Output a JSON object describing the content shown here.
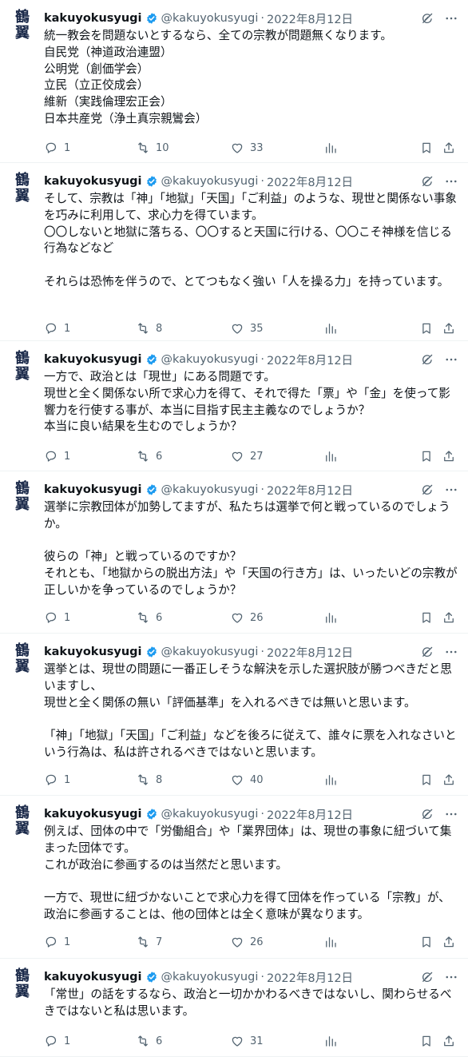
{
  "tweets": [
    {
      "avatar_glyph": "鶴翼",
      "user_name": "kakuyokusyugi",
      "handle": "@kakuyokusyugi",
      "separator": "·",
      "date": "2022年8月12日",
      "text": "統一教会を問題ないとするなら、全ての宗教が問題無くなります。\n自民党（神道政治連盟）\n公明党（創価学会）\n立民（立正佼成会）\n維新（実践倫理宏正会）\n日本共産党（浄土真宗親鸞会）",
      "replies": "1",
      "retweets": "10",
      "likes": "33"
    },
    {
      "avatar_glyph": "鶴翼",
      "user_name": "kakuyokusyugi",
      "handle": "@kakuyokusyugi",
      "separator": "·",
      "date": "2022年8月12日",
      "text": "そして、宗教は「神」「地獄」「天国」「ご利益」のような、現世と関係ない事象を巧みに利用して、求心力を得ています。\n〇〇しないと地獄に落ちる、〇〇すると天国に行ける、〇〇こそ神様を信じる行為などなど\n\nそれらは恐怖を伴うので、とてつもなく強い「人を操る力」を持っています。",
      "replies": "1",
      "retweets": "8",
      "likes": "35"
    },
    {
      "avatar_glyph": "鶴翼",
      "user_name": "kakuyokusyugi",
      "handle": "@kakuyokusyugi",
      "separator": "·",
      "date": "2022年8月12日",
      "text": "一方で、政治とは「現世」にある問題です。\n現世と全く関係ない所で求心力を得て、それで得た「票」や「金」を使って影響力を行使する事が、本当に目指す民主主義なのでしょうか？\n本当に良い結果を生むのでしょうか？",
      "replies": "1",
      "retweets": "6",
      "likes": "27"
    },
    {
      "avatar_glyph": "鶴翼",
      "user_name": "kakuyokusyugi",
      "handle": "@kakuyokusyugi",
      "separator": "·",
      "date": "2022年8月12日",
      "text": "選挙に宗教団体が加勢してますが、私たちは選挙で何と戦っているのでしょうか。\n\n彼らの「神」と戦っているのですか？\nそれとも、「地獄からの脱出方法」や「天国の行き方」は、いったいどの宗教が正しいかを争っているのでしょうか？",
      "replies": "1",
      "retweets": "6",
      "likes": "26"
    },
    {
      "avatar_glyph": "鶴翼",
      "user_name": "kakuyokusyugi",
      "handle": "@kakuyokusyugi",
      "separator": "·",
      "date": "2022年8月12日",
      "text": "選挙とは、現世の問題に一番正しそうな解決を示した選択肢が勝つべきだと思いますし、\n現世と全く関係の無い「評価基準」を入れるべきでは無いと思います。\n\n「神」「地獄」「天国」「ご利益」などを後ろに従えて、誰々に票を入れなさいという行為は、私は許されるべきではないと思います。",
      "replies": "1",
      "retweets": "8",
      "likes": "40"
    },
    {
      "avatar_glyph": "鶴翼",
      "user_name": "kakuyokusyugi",
      "handle": "@kakuyokusyugi",
      "separator": "·",
      "date": "2022年8月12日",
      "text": "例えば、団体の中で「労働組合」や「業界団体」は、現世の事象に紐づいて集まった団体です。\nこれが政治に参画するのは当然だと思います。\n\n一方で、現世に紐づかないことで求心力を得て団体を作っている「宗教」が、政治に参画することは、他の団体とは全く意味が異なります。",
      "replies": "1",
      "retweets": "7",
      "likes": "26"
    },
    {
      "avatar_glyph": "鶴翼",
      "user_name": "kakuyokusyugi",
      "handle": "@kakuyokusyugi",
      "separator": "·",
      "date": "2022年8月12日",
      "text": "「常世」の話をするなら、政治と一切かかわるべきではないし、関わらせるべきではないと私は思います。",
      "replies": "1",
      "retweets": "6",
      "likes": "31"
    }
  ],
  "icons": {
    "verified": "verified-badge-icon",
    "grok": "grok-icon",
    "more": "more-icon",
    "reply": "reply-icon",
    "retweet": "retweet-icon",
    "like": "like-icon",
    "views": "views-icon",
    "bookmark": "bookmark-icon",
    "share": "share-icon"
  },
  "colors": {
    "verified": "#1d9bf0",
    "muted": "#536471",
    "text": "#0f1419",
    "avatar": "#1b2a4a"
  }
}
